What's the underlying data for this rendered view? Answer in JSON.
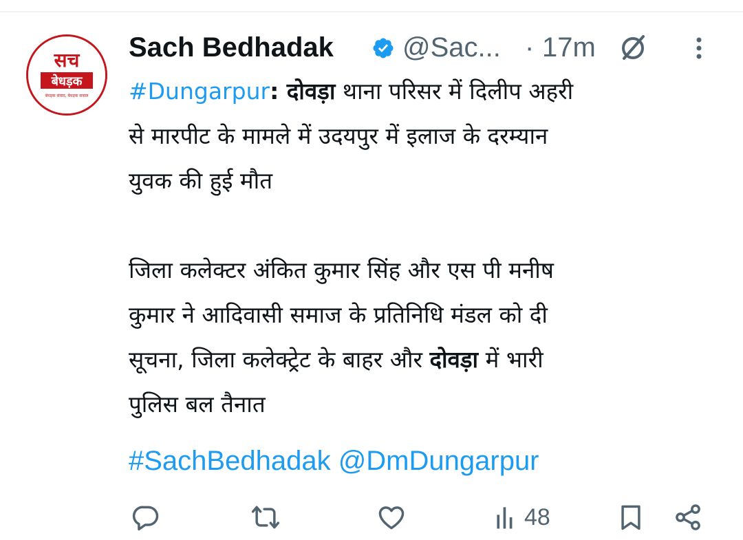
{
  "tweet": {
    "author_name": "Sach Bedhadak",
    "handle": "@Sac...",
    "separator": "·",
    "time": "17m",
    "avatar_logo": {
      "line1": "सच",
      "line2": "बेधड़क",
      "tagline": "बेधड़क संवाद, बेधड़क सवाल"
    },
    "body": {
      "p1_hashtag": "#Dungarpur",
      "p1_colon": ": ",
      "p1_bold1": "दोवड़ा",
      "p1_text1": " थाना परिसर में दिलीप अहरी",
      "p1_line2": "से मारपीट के मामले में उदयपुर में इलाज के दरम्यान",
      "p1_line3": "युवक की हुई मौत",
      "p2_line1": "जिला कलेक्टर अंकित कुमार सिंह और एस पी मनीष",
      "p2_line2": "कुमार ने आदिवासी समाज के प्रतिनिधि मंडल को दी",
      "p2_line3_a": "सूचना, जिला कलेक्ट्रेट के बाहर और ",
      "p2_line3_bold": "दोवड़ा",
      "p2_line3_b": " में भारी",
      "p2_line4": "पुलिस बल तैनात"
    },
    "tags_line": "#SachBedhadak @DmDungarpur",
    "views": "48"
  },
  "colors": {
    "link": "#1d9bf0",
    "muted": "#536471",
    "text": "#0f1419",
    "brand_red": "#c4161c"
  },
  "icons": {
    "verified": "verified-badge-icon",
    "grok": "grok-icon",
    "more": "more-vertical-icon",
    "reply": "reply-icon",
    "retweet": "retweet-icon",
    "like": "like-icon",
    "views": "views-icon",
    "bookmark": "bookmark-icon",
    "share": "share-icon"
  }
}
